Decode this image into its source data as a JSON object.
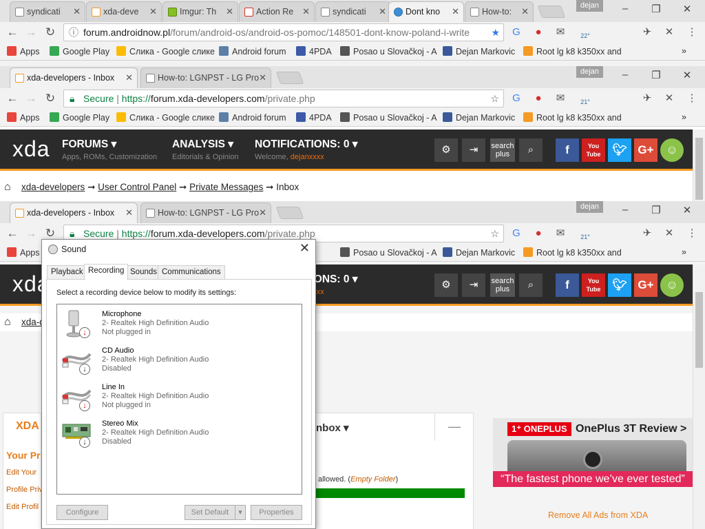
{
  "win1": {
    "tabs": [
      {
        "label": "syndicati"
      },
      {
        "label": "xda-deve"
      },
      {
        "label": "Imgur: Th"
      },
      {
        "label": "Action Re"
      },
      {
        "label": "syndicati"
      },
      {
        "label": "Dont kno"
      },
      {
        "label": "How-to:"
      }
    ],
    "profile": "dejan",
    "url_domain": "forum.androidnow.pl",
    "url_path": "/forum/android-os/android-os-pomoc/148501-dont-know-poland-i-write",
    "weather": "22°"
  },
  "win2": {
    "tabs": [
      {
        "label": "xda-developers - Inbox"
      },
      {
        "label": "How-to: LGNPST - LG Pro"
      }
    ],
    "profile": "dejan",
    "secure": "Secure",
    "url_scheme": "https://",
    "url_domain": "forum.xda-developers.com",
    "url_path": "/private.php",
    "weather": "21°"
  },
  "bookmarks": [
    {
      "label": "Apps",
      "color": "#e8453c"
    },
    {
      "label": "Google Play",
      "color": "#34a853"
    },
    {
      "label": "Слика - Google слике",
      "color": "#fbbc05"
    },
    {
      "label": "Android forum",
      "color": "#5c7fa8"
    },
    {
      "label": "4PDA",
      "color": "#3c5aa8"
    },
    {
      "label": "Posao u Slovačkoj - A",
      "color": "#555555"
    },
    {
      "label": "Dejan Markovic",
      "color": "#3b5998"
    },
    {
      "label": "Root lg k8 k350xx and",
      "color": "#f59a23"
    }
  ],
  "xda": {
    "logo": "xda",
    "forums": "FORUMS",
    "forums_sub": "Apps, ROMs, Customization",
    "analysis": "ANALYSIS",
    "analysis_sub": "Editorials & Opinion",
    "notifications": "NOTIFICATIONS:",
    "notifications_count": "0",
    "welcome": "Welcome,",
    "username": "dejanxxxx",
    "search1": "search",
    "search2": "plus",
    "fb": "f",
    "yt": "You Tube",
    "gplus": "G+",
    "crumbs": [
      "xda-developers",
      "User Control Panel",
      "Private Messages",
      "Inbox"
    ],
    "crumb_sep": "➞"
  },
  "page": {
    "inbox_label": "nbox",
    "panel_title": "XDA",
    "your_profile": "Your Pr",
    "links": [
      "Edit Your",
      "Profile Priv",
      "Edit Profil"
    ],
    "allowed_text": "allowed.",
    "empty_folder": "Empty Folder",
    "ad_brand": "ONEPLUS",
    "ad_title": "OnePlus 3T Review >",
    "ad_quote": "“The fastest phone we’ve ever tested”",
    "remove_ads": "Remove All Ads from XDA"
  },
  "sound": {
    "title": "Sound",
    "tabs": [
      "Playback",
      "Recording",
      "Sounds",
      "Communications"
    ],
    "instruction": "Select a recording device below to modify its settings:",
    "devices": [
      {
        "name": "Microphone",
        "driver": "2- Realtek High Definition Audio",
        "status": "Not plugged in"
      },
      {
        "name": "CD Audio",
        "driver": "2- Realtek High Definition Audio",
        "status": "Disabled"
      },
      {
        "name": "Line In",
        "driver": "2- Realtek High Definition Audio",
        "status": "Not plugged in"
      },
      {
        "name": "Stereo Mix",
        "driver": "2- Realtek High Definition Audio",
        "status": "Disabled"
      }
    ],
    "configure": "Configure",
    "set_default": "Set Default",
    "properties": "Properties"
  },
  "colors": {
    "accent": "#f59a23",
    "xda_bar": "#2b2b2b",
    "unplugged": "#cc0000"
  }
}
